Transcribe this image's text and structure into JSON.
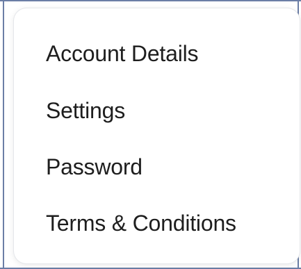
{
  "menu": {
    "items": [
      {
        "label": "Account Details"
      },
      {
        "label": "Settings"
      },
      {
        "label": "Password"
      },
      {
        "label": "Terms & Conditions"
      }
    ]
  }
}
